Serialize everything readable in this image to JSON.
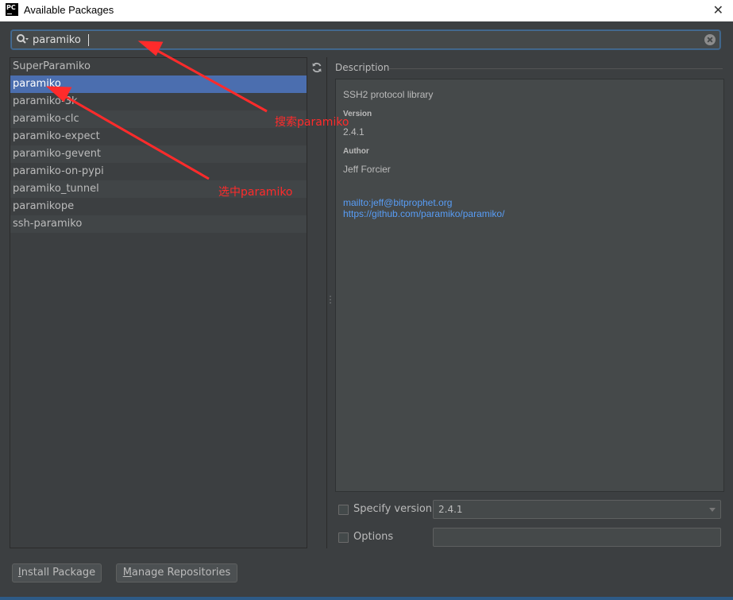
{
  "window": {
    "app_icon_text": "PC",
    "title": "Available Packages",
    "close_glyph": "✕"
  },
  "search": {
    "value": "paramiko",
    "icon": "search-icon",
    "clear_icon": "clear-icon"
  },
  "packages": [
    {
      "name": "SuperParamiko",
      "selected": false
    },
    {
      "name": "paramiko",
      "selected": true
    },
    {
      "name": "paramiko-3k",
      "selected": false
    },
    {
      "name": "paramiko-clc",
      "selected": false
    },
    {
      "name": "paramiko-expect",
      "selected": false
    },
    {
      "name": "paramiko-gevent",
      "selected": false
    },
    {
      "name": "paramiko-on-pypi",
      "selected": false
    },
    {
      "name": "paramiko_tunnel",
      "selected": false
    },
    {
      "name": "paramikope",
      "selected": false
    },
    {
      "name": "ssh-paramiko",
      "selected": false
    }
  ],
  "toolbar": {
    "refresh_icon": "refresh-icon"
  },
  "description": {
    "header": "Description",
    "summary": "SSH2 protocol library",
    "version_label": "Version",
    "version": "2.4.1",
    "author_label": "Author",
    "author": "Jeff Forcier",
    "links": [
      "mailto:jeff@bitprophet.org",
      "https://github.com/paramiko/paramiko/"
    ]
  },
  "options": {
    "specify_version_label": "Specify version",
    "specify_version_checked": false,
    "version_value": "2.4.1",
    "options_label": "Options",
    "options_checked": false,
    "options_value": ""
  },
  "buttons": {
    "install_prefix": "",
    "install_mnemonic": "I",
    "install_rest": "nstall Package",
    "manage_prefix": "",
    "manage_mnemonic": "M",
    "manage_rest": "anage Repositories"
  },
  "annotations": {
    "search_note": "搜索paramiko",
    "select_note": "选中paramiko",
    "color": "#ff2b2b"
  },
  "colors": {
    "background": "#3c3f41",
    "selection": "#4b6eaf",
    "link": "#589df6",
    "focus_border": "#466d94"
  }
}
